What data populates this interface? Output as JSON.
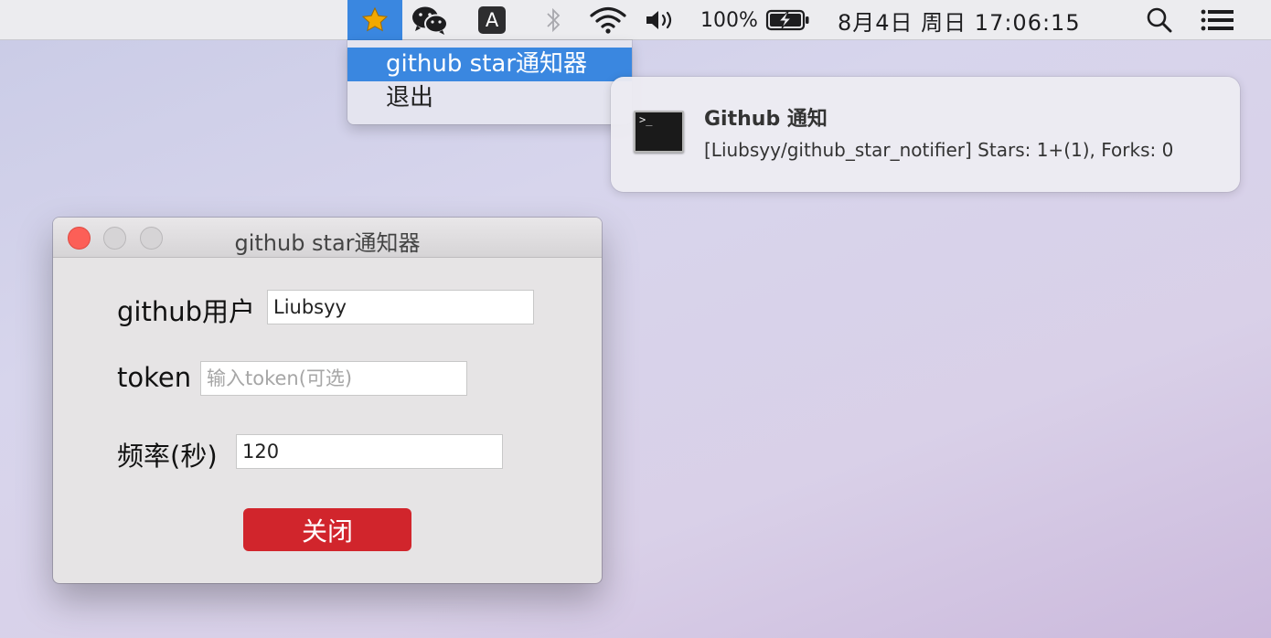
{
  "menubar": {
    "battery_percent": "100%",
    "datetime": "8月4日 周日  17:06:15",
    "input_source": "A",
    "icons": [
      "star-icon",
      "wechat-icon",
      "input-source-icon",
      "bluetooth-icon",
      "wifi-icon",
      "volume-icon",
      "battery-charging-icon",
      "search-icon",
      "list-icon"
    ]
  },
  "dropdown": {
    "items": [
      {
        "label": "github star通知器",
        "selected": true
      },
      {
        "label": "退出",
        "selected": false
      }
    ]
  },
  "notification": {
    "title": "Github 通知",
    "body": "[Liubsyy/github_star_notifier] Stars: 1+(1), Forks: 0",
    "icon_prompt": ">_"
  },
  "window": {
    "title": "github star通知器",
    "fields": {
      "user_label": "github用户",
      "user_value": "Liubsyy",
      "token_label": "token",
      "token_placeholder": "输入token(可选)",
      "token_value": "",
      "freq_label": "频率(秒)",
      "freq_value": "120"
    },
    "close_button": "关闭"
  },
  "colors": {
    "accent": "#3a87e0",
    "close_button": "#d1252c",
    "star": "#f2a900"
  }
}
